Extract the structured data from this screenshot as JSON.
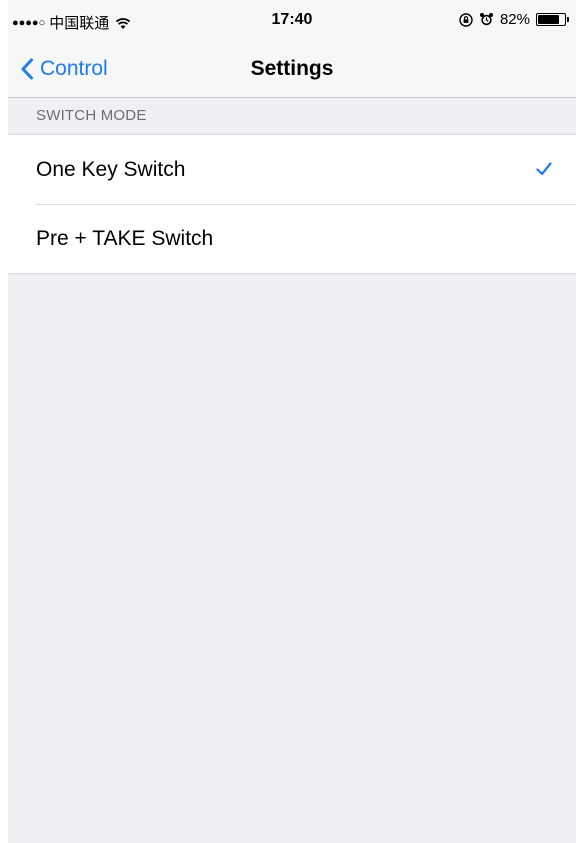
{
  "status_bar": {
    "signal": "●●●●○",
    "carrier": "中国联通",
    "time": "17:40",
    "battery_percent": "82%",
    "battery_level": 0.82,
    "icons": [
      "wifi-icon",
      "orientation-lock-icon",
      "alarm-icon",
      "battery-icon"
    ]
  },
  "nav": {
    "back_label": "Control",
    "title": "Settings"
  },
  "section": {
    "header": "SWITCH MODE",
    "items": [
      {
        "label": "One Key Switch",
        "selected": true
      },
      {
        "label": "Pre + TAKE Switch",
        "selected": false
      }
    ]
  },
  "colors": {
    "accent": "#1e7cf2",
    "background": "#efeff4",
    "bar_background": "#f7f7f7",
    "section_header_text": "#6d6d72"
  }
}
